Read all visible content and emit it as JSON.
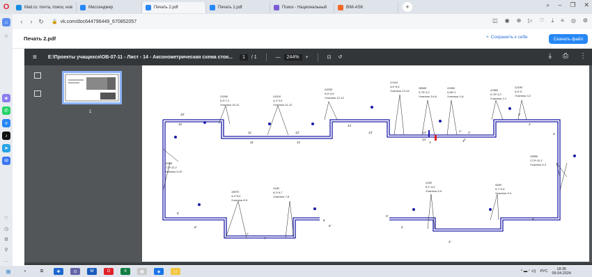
{
  "browser": {
    "tabs": [
      {
        "label": "Mail.ru: почта, поиск, нов",
        "color": "#168de2"
      },
      {
        "label": "Мессенджер",
        "color": "#2787f5"
      },
      {
        "label": "Печать 2.pdf",
        "color": "#2787f5"
      },
      {
        "label": "Печать 1.pdf",
        "color": "#2787f5"
      },
      {
        "label": "Поиск - Национальный",
        "color": "#7a5bd6"
      },
      {
        "label": "BIM-ASK",
        "color": "#f26522"
      }
    ],
    "url": "vk.com/doc644796449_670852057"
  },
  "doc_header": {
    "title": "Печать 2.pdf",
    "save_label": "Сохранить к себе",
    "download_label": "Скачать файл"
  },
  "pdf_toolbar": {
    "filename": "E:\\Проекты учащихся\\ОВ-07-11 - Лист - 14 - Аксонометрическая схема стоя...",
    "page_current": "1",
    "page_total": "/ 1",
    "zoom": "244%",
    "minus": "—",
    "plus": "+"
  },
  "thumbnail": {
    "page_number": "1"
  },
  "drawing": {
    "labels": [
      {
        "t": "23260",
        "l2": "5,5÷7,1",
        "l3": "Участок 10-11"
      },
      {
        "t": "24310",
        "l2": "4,3÷3,5",
        "l3": "Участок 11-12"
      },
      {
        "t": "29250",
        "l2": "6,9÷4,9",
        "l3": "Участок 12-13"
      },
      {
        "t": "37410",
        "l2": "4,6÷6,9",
        "l3": "Участок 13-14"
      },
      {
        "t": "38840",
        "l2": "0,79÷3,2",
        "l3": "Участок 14-А"
      },
      {
        "t": "22860",
        "l2": "0,68÷3",
        "l3": "Участок 1-А"
      },
      {
        "t": "22860",
        "l2": "0,79÷3,2",
        "l3": "Участок 2-1"
      },
      {
        "t": "22180",
        "l2": "5,5÷5",
        "l3": "Участок 3-2"
      },
      {
        "t": "15958",
        "l2": "17,8÷11,3",
        "l3": "Участок 9-10"
      },
      {
        "t": "15890",
        "l2": "17,8÷11,3",
        "l3": "Участок 4-3"
      },
      {
        "t": "18870",
        "l2": "4,2÷5,5",
        "l3": "Участок 8-9"
      },
      {
        "t": "3180",
        "l2": "6,3÷6,7",
        "l3": "Участок 7-8"
      },
      {
        "t": "3180",
        "l2": "8,1÷4,5",
        "l3": "Участок 6-5"
      },
      {
        "t": "5940",
        "l2": "5,7÷6,9",
        "l3": "Участок 5-4"
      }
    ],
    "nodes": [
      "10'",
      "10",
      "11'",
      "11",
      "12'",
      "12",
      "13'",
      "13",
      "14'",
      "14",
      "А",
      "1'",
      "1",
      "2'",
      "2",
      "3'",
      "3",
      "9",
      "8'",
      "8",
      "7",
      "7'",
      "6",
      "6'",
      "5'",
      "5",
      "4'",
      "4",
      "13",
      "Т1"
    ]
  },
  "taskbar": {
    "tray_lang": "РУС",
    "time": "18:35",
    "date": "09.04.2024"
  }
}
